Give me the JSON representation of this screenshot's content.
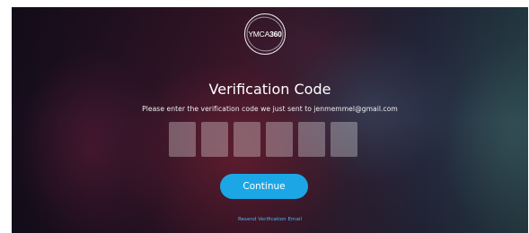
{
  "logo": {
    "prefix": "YMCA",
    "suffix": "360"
  },
  "verification": {
    "title": "Verification Code",
    "instructions": "Please enter the verification code we just sent to jenmemmel@gmail.com",
    "code_digits": [
      "",
      "",
      "",
      "",
      "",
      ""
    ]
  },
  "actions": {
    "continue_label": "Continue",
    "resend_label": "Resend Verification Email"
  },
  "colors": {
    "accent": "#1ba7e6",
    "link": "#4fb4ea"
  }
}
